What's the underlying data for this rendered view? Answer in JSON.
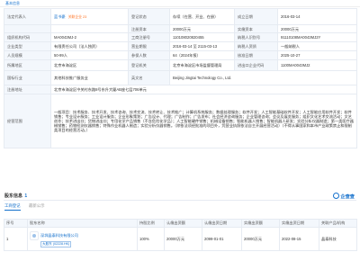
{
  "topbar": {
    "left": "基本信息",
    "mid": "",
    "right": ""
  },
  "info": {
    "legal_rep_k": "法定代表人",
    "legal_rep": "蓝书豪",
    "legal_rep_tag": "关联企业 23",
    "status_k": "登记状态",
    "status": "存续（在营、开业、在册）",
    "founded_k": "成立日期",
    "founded": "2016-03-14",
    "reg_cap_k": "注册资本",
    "reg_cap": "20000万元",
    "paid_cap_k": "实缴资本",
    "paid_cap": "20000万元",
    "org_code_k": "组织机构代码",
    "org_code": "MA0043MJ-2",
    "biz_reg_k": "工商注册号",
    "biz_reg": "110108020820455",
    "tax_k": "纳税人识别号",
    "tax": "91110108MA0043MJ2Y",
    "type_k": "企业类型",
    "type": "有限责任公司（法人独资）",
    "term_k": "营业期限",
    "term": "2016-03-14 至 2115-03-13",
    "tax_q_k": "纳税人资质",
    "tax_q": "一般纳税人",
    "staff_k": "人员规模",
    "staff": "50-99人",
    "insured_k": "参保人数",
    "insured": "64（2024年报）",
    "approved_k": "核准日期",
    "approved": "2025-10-27",
    "region_k": "所属地区",
    "region": "北京市海淀区",
    "authority_k": "登记机关",
    "authority": "北京市海淀区市场监督管理局",
    "import_k": "进出口企业代码",
    "import": "1100MA0043MJ2",
    "industry_k": "国标行业",
    "industry": "其他科技推广服务业",
    "en_name_k": "英文名",
    "en_name": "Beijing Jingtai Technology Co., Ltd.",
    "address_k": "注册地址",
    "address": "北京市海淀区中关村东路8号东升大厦AB座七层706单元",
    "scope_k": "经营范围",
    "scope": "一般项目：技术服务、技术开发、技术咨询、技术交流、技术转让、技术推广；计算机系统服务；数据处理服务；软件开发；人工智能基础软件开发；人工智能应用软件开发；软件销售；专业设计服务；工业设计服务；企业形象策划；广告设计、代理；广告制作；广告发布；社会经济咨询服务；企业管理咨询；会议及展览服务；组织文化艺术交流活动；文艺创作；技术进出口；货物进出口；专用化学产品销售（不含危险化学品）；人工智能硬件销售；机械设备销售；智能机器人销售；智能机器人研发；实验分析仪器制造；第一类医疗器械销售；药物检测仪器销售；特殊作业机器人制造；实验分析仪器销售。（除依法须经批准的项目外，凭营业执照依法自主开展经营活动）（不得从事国家和本市产业政策禁止和限制类项目的经营活动。）"
  },
  "shareholders": {
    "section_title": "股东信息",
    "section_count": "1",
    "brand": "企查查",
    "tab_active": "工商登记",
    "tab_other": "最新公示",
    "headers": [
      "序号",
      "股东名称",
      "持股比例",
      "认缴出资额",
      "认缴出资日期",
      "实缴出资额",
      "实缴出资日期",
      "关联产品/机构"
    ],
    "rows": [
      {
        "idx": "1",
        "name": "深圳晶泰科技有限公司",
        "badge": "大股东 (02228.HK)",
        "ratio": "100%",
        "sub_amt": "20000万元",
        "sub_date": "2099-01-01",
        "paid_amt": "20000万元",
        "paid_date": "2022-08-15",
        "product": "晶泰科技"
      }
    ]
  },
  "below": {
    "text": ""
  }
}
